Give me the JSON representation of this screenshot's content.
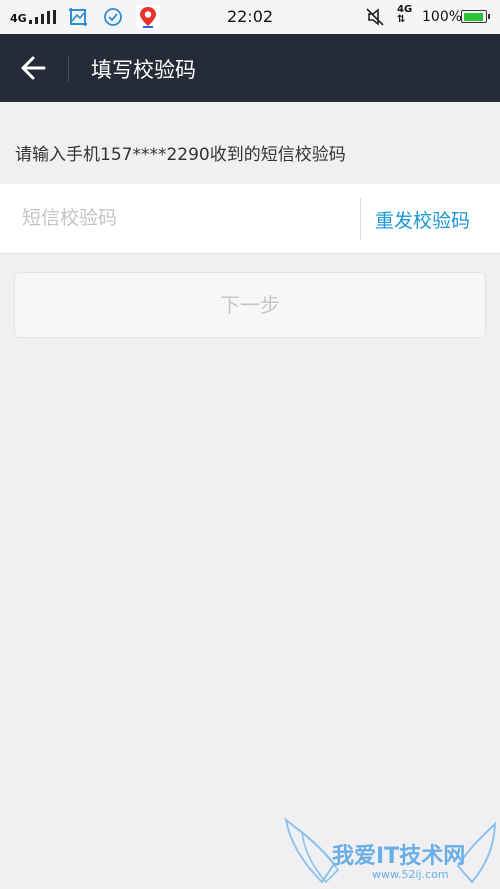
{
  "status_bar": {
    "network": "4G",
    "time": "22:02",
    "network2": "4G",
    "battery": "100%"
  },
  "header": {
    "title": "填写校验码"
  },
  "prompt": {
    "text": "请输入手机157****2290收到的短信校验码"
  },
  "code_input": {
    "placeholder": "短信校验码",
    "value": ""
  },
  "resend": {
    "label": "重发校验码"
  },
  "next": {
    "label": "下一步"
  },
  "watermark": {
    "text": "我爱IT技术网",
    "url": "www.52ij.com"
  },
  "colors": {
    "header_bg": "#262b3a",
    "accent": "#1996d7",
    "background": "#f0f0f3",
    "disabled_text": "#c6c6c6"
  }
}
